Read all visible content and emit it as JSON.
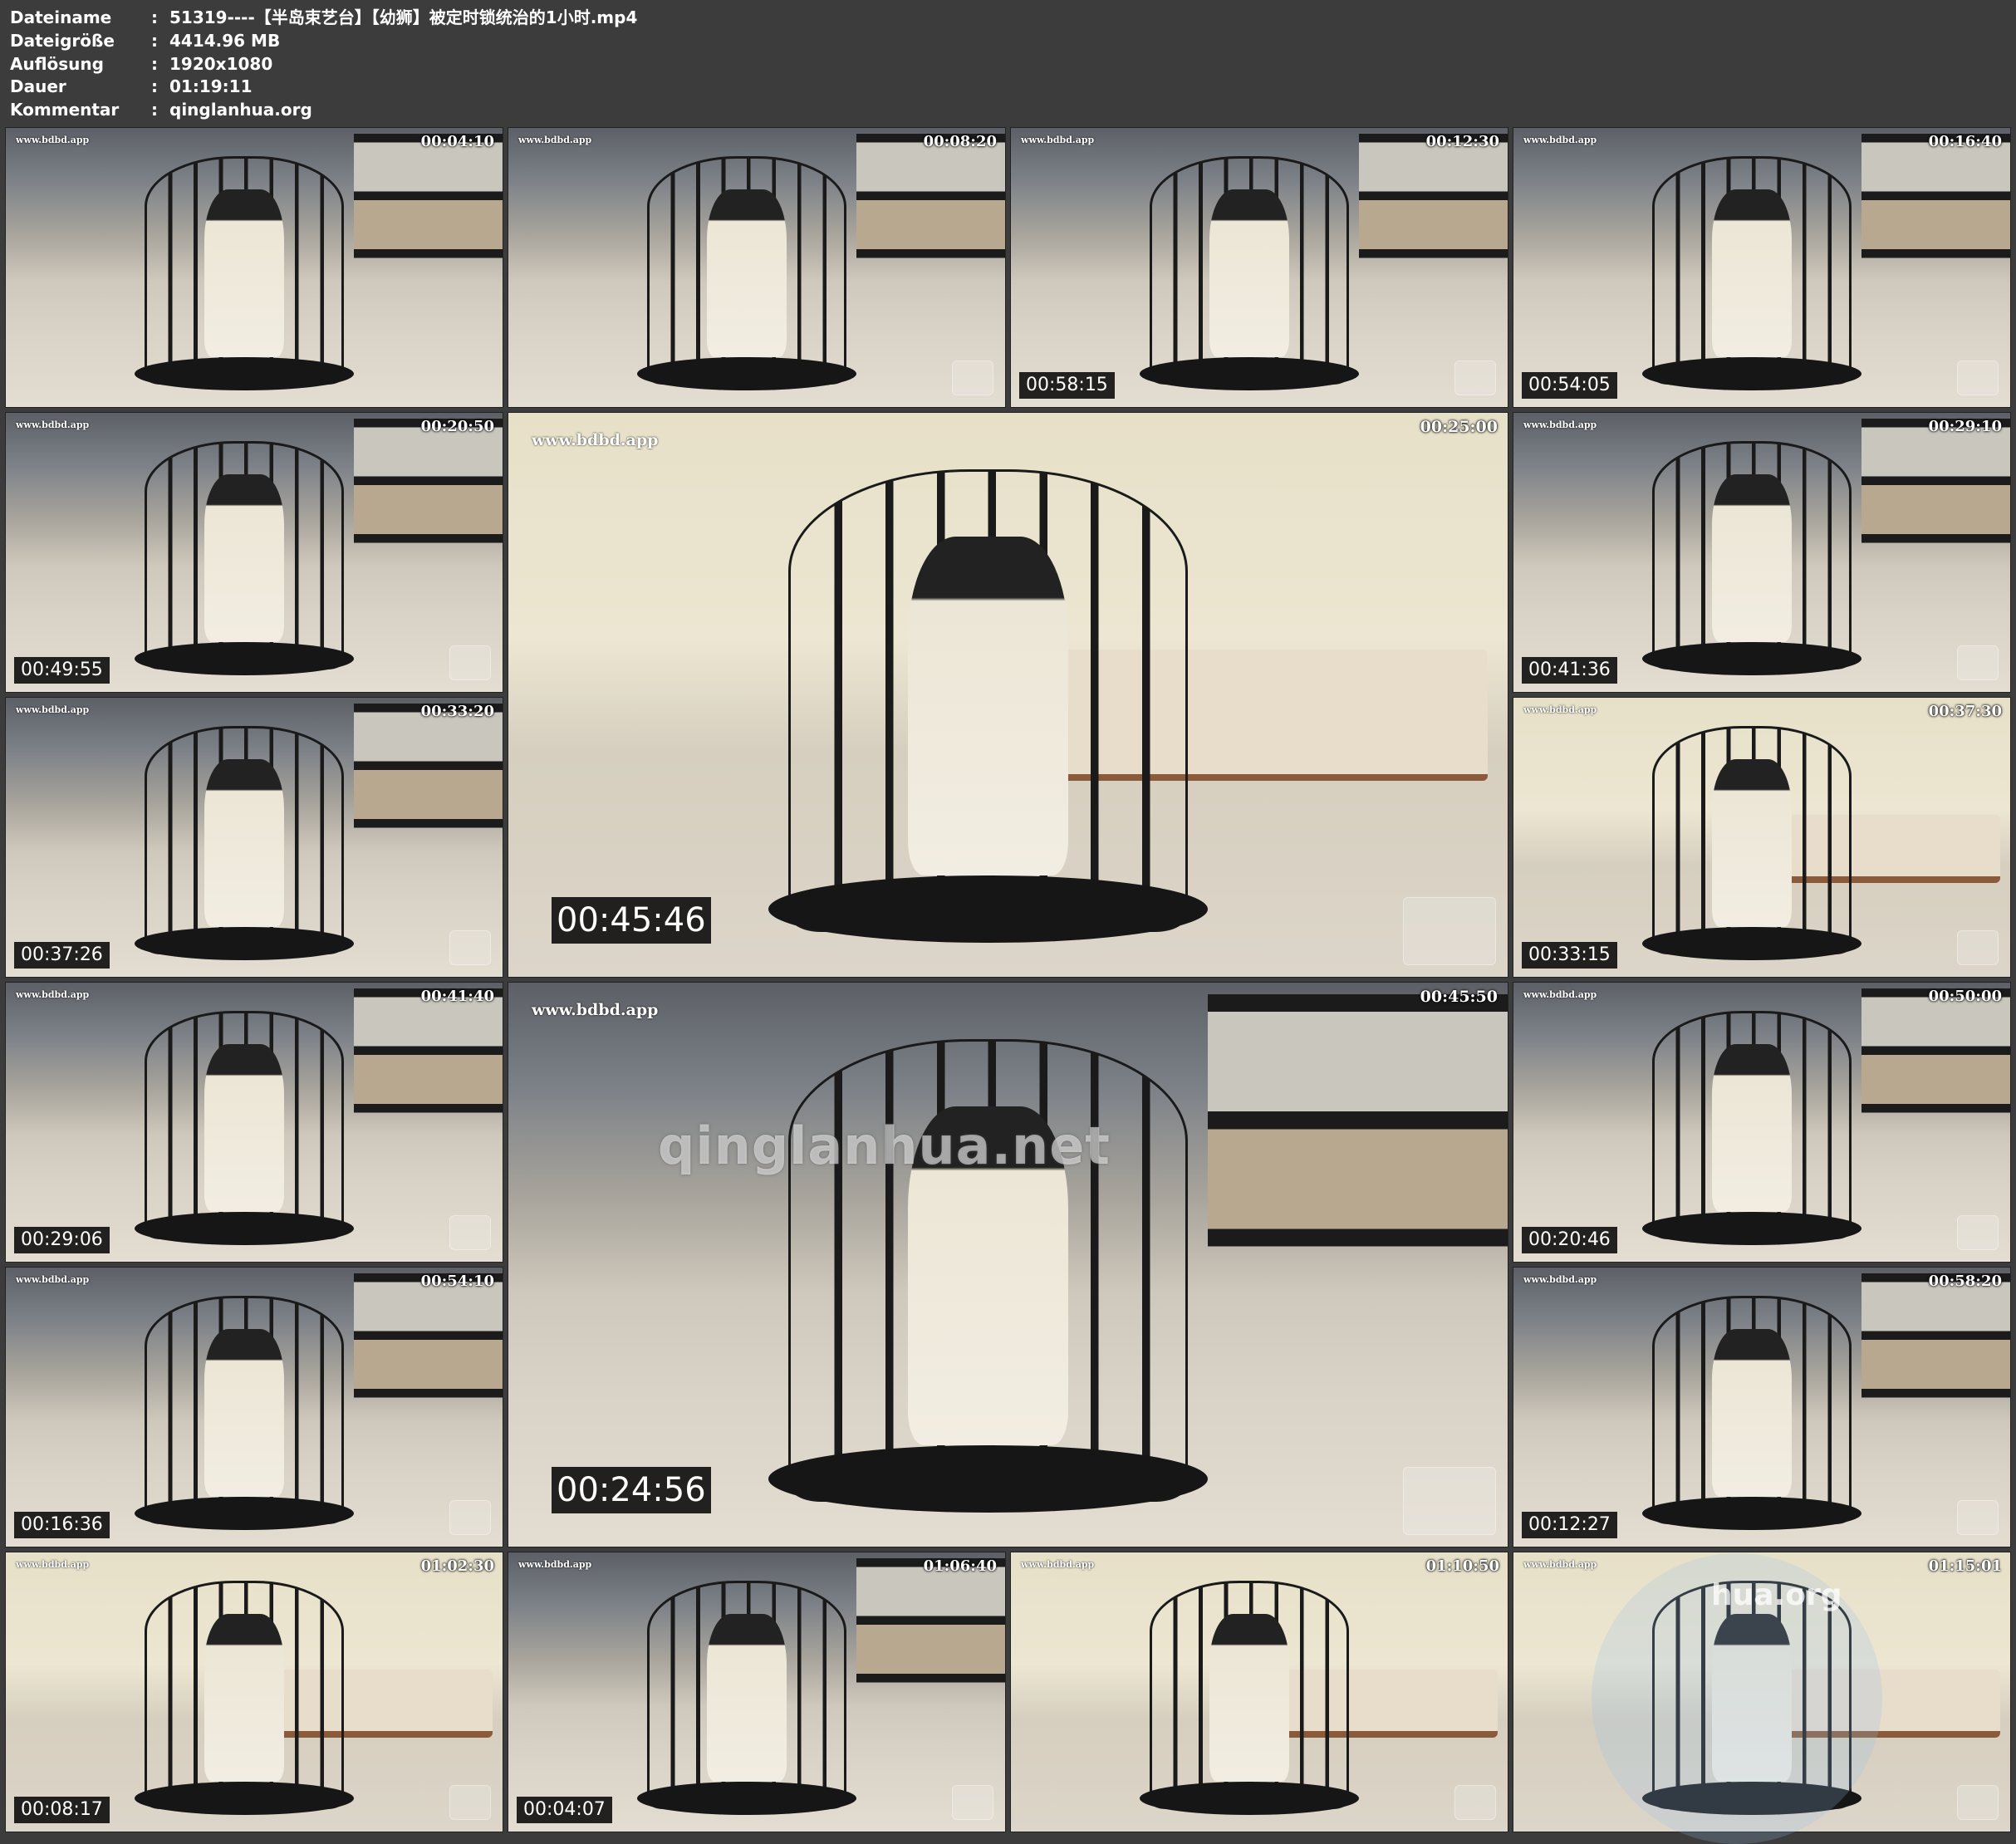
{
  "meta": [
    {
      "label": "Dateiname",
      "value": "51319----【半岛束艺台】【幼狮】被定时锁统治的1小时.mp4"
    },
    {
      "label": "Dateigröße",
      "value": "4414.96 MB"
    },
    {
      "label": "Auflösung",
      "value": "1920x1080"
    },
    {
      "label": "Dauer",
      "value": "01:19:11"
    },
    {
      "label": "Kommentar",
      "value": "qinglanhua.org"
    }
  ],
  "colon": ":",
  "watermark": "www.bdbd.app",
  "overlay_text": "qinglanhua.net",
  "corner_watermark": "hua.org",
  "thumbs": [
    {
      "tc": "00:04:10",
      "tc2": ""
    },
    {
      "tc": "00:08:20",
      "tc2": ""
    },
    {
      "tc": "00:12:30",
      "tc2": "00:58:15"
    },
    {
      "tc": "00:16:40",
      "tc2": "00:54:05"
    },
    {
      "tc": "00:20:50",
      "tc2": "00:49:55"
    },
    {
      "tc": "00:25:00",
      "tc2": "00:45:46"
    },
    {
      "tc": "00:29:10",
      "tc2": "00:41:36"
    },
    {
      "tc": "00:33:20",
      "tc2": "00:37:26"
    },
    {
      "tc": "00:37:30",
      "tc2": "00:33:15"
    },
    {
      "tc": "00:41:40",
      "tc2": "00:29:06"
    },
    {
      "tc": "00:45:50",
      "tc2": "00:24:56"
    },
    {
      "tc": "00:50:00",
      "tc2": "00:20:46"
    },
    {
      "tc": "00:54:10",
      "tc2": "00:16:36"
    },
    {
      "tc": "00:58:20",
      "tc2": "00:12:27"
    },
    {
      "tc": "01:02:30",
      "tc2": "00:08:17"
    },
    {
      "tc": "01:06:40",
      "tc2": "00:04:07"
    },
    {
      "tc": "01:10:50",
      "tc2": ""
    },
    {
      "tc": "01:15:01",
      "tc2": ""
    }
  ]
}
